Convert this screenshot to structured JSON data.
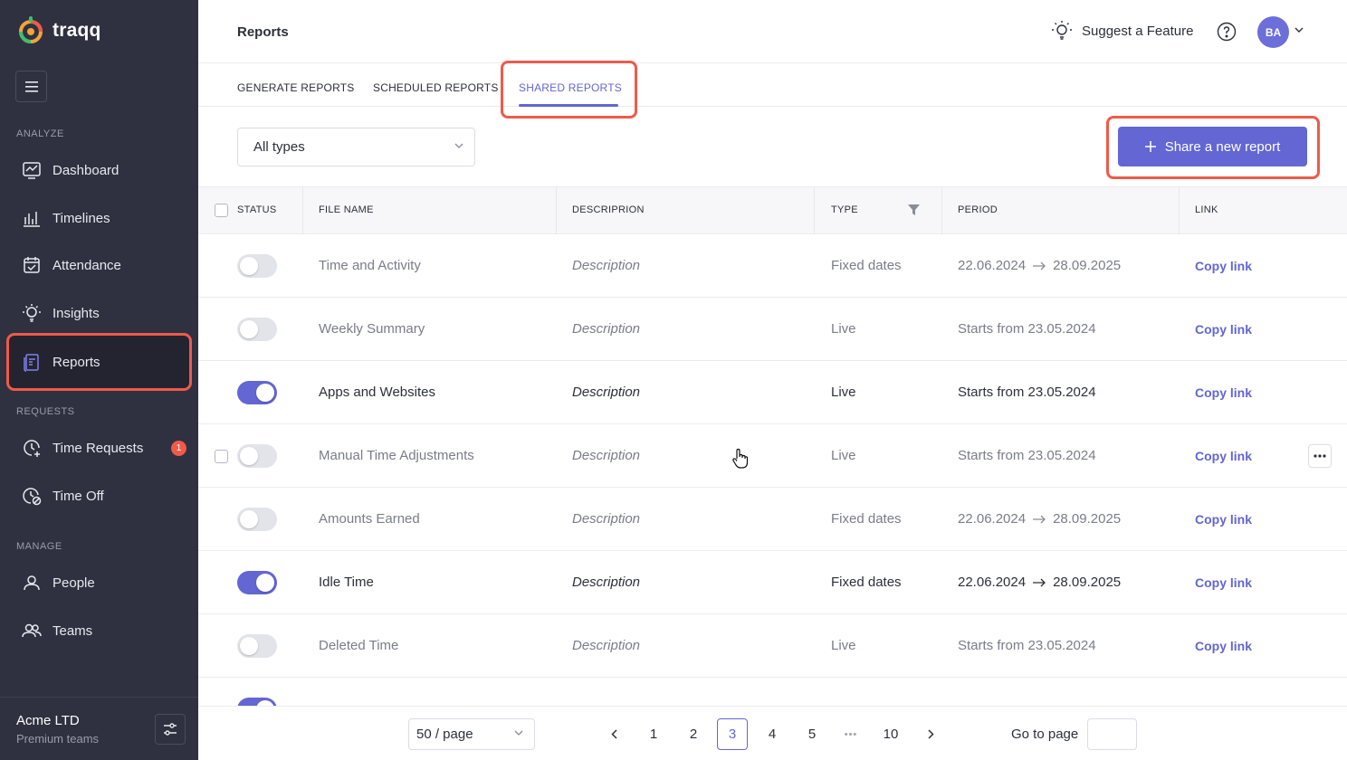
{
  "app": {
    "brand": "traqq",
    "accent": "#6366d3",
    "highlight": "#ef5a4a"
  },
  "sidebar": {
    "sections": {
      "analyze": "ANALYZE",
      "requests": "REQUESTS",
      "manage": "MANAGE"
    },
    "items": [
      {
        "label": "Dashboard",
        "icon": "dashboard-icon"
      },
      {
        "label": "Timelines",
        "icon": "timelines-icon"
      },
      {
        "label": "Attendance",
        "icon": "calendar-icon"
      },
      {
        "label": "Insights",
        "icon": "lightbulb-icon"
      },
      {
        "label": "Reports",
        "icon": "reports-icon",
        "active": true
      },
      {
        "label": "Time Requests",
        "icon": "time-request-icon",
        "badge": "1"
      },
      {
        "label": "Time Off",
        "icon": "time-off-icon"
      },
      {
        "label": "People",
        "icon": "person-icon"
      },
      {
        "label": "Teams",
        "icon": "teams-icon"
      }
    ],
    "org": {
      "name": "Acme LTD",
      "plan": "Premium teams"
    }
  },
  "header": {
    "title": "Reports",
    "suggest": "Suggest a Feature",
    "avatar": "BA"
  },
  "tabs": [
    {
      "label": "GENERATE REPORTS"
    },
    {
      "label": "SCHEDULED REPORTS"
    },
    {
      "label": "SHARED REPORTS",
      "active": true
    }
  ],
  "toolbar": {
    "filter_value": "All types",
    "share_label": "Share a new report"
  },
  "table": {
    "columns": [
      "STATUS",
      "FILE NAME",
      "DESCRIPRION",
      "TYPE",
      "PERIOD",
      "LINK"
    ],
    "rows": [
      {
        "on": false,
        "name": "Time and Activity",
        "description": "Description",
        "type": "Fixed dates",
        "period_from": "22.06.2024",
        "period_to": "28.09.2025",
        "link": "Copy link"
      },
      {
        "on": false,
        "name": "Weekly Summary",
        "description": "Description",
        "type": "Live",
        "period_text": "Starts from 23.05.2024",
        "link": "Copy link"
      },
      {
        "on": true,
        "name": "Apps and Websites",
        "description": "Description",
        "type": "Live",
        "period_text": "Starts from 23.05.2024",
        "link": "Copy link"
      },
      {
        "on": false,
        "name": "Manual Time Adjustments",
        "description": "Description",
        "type": "Live",
        "period_text": "Starts from 23.05.2024",
        "link": "Copy link",
        "hover": true
      },
      {
        "on": false,
        "name": "Amounts Earned",
        "description": "Description",
        "type": "Fixed dates",
        "period_from": "22.06.2024",
        "period_to": "28.09.2025",
        "link": "Copy link"
      },
      {
        "on": true,
        "name": "Idle Time",
        "description": "Description",
        "type": "Fixed dates",
        "period_from": "22.06.2024",
        "period_to": "28.09.2025",
        "link": "Copy link"
      },
      {
        "on": false,
        "name": "Deleted Time",
        "description": "Description",
        "type": "Live",
        "period_text": "Starts from 23.05.2024",
        "link": "Copy link"
      }
    ]
  },
  "pagination": {
    "per_page": "50 / page",
    "pages": [
      "1",
      "2",
      "3",
      "4",
      "5",
      "10"
    ],
    "current": "3",
    "ellipsis": "•••",
    "goto_label": "Go to page"
  }
}
